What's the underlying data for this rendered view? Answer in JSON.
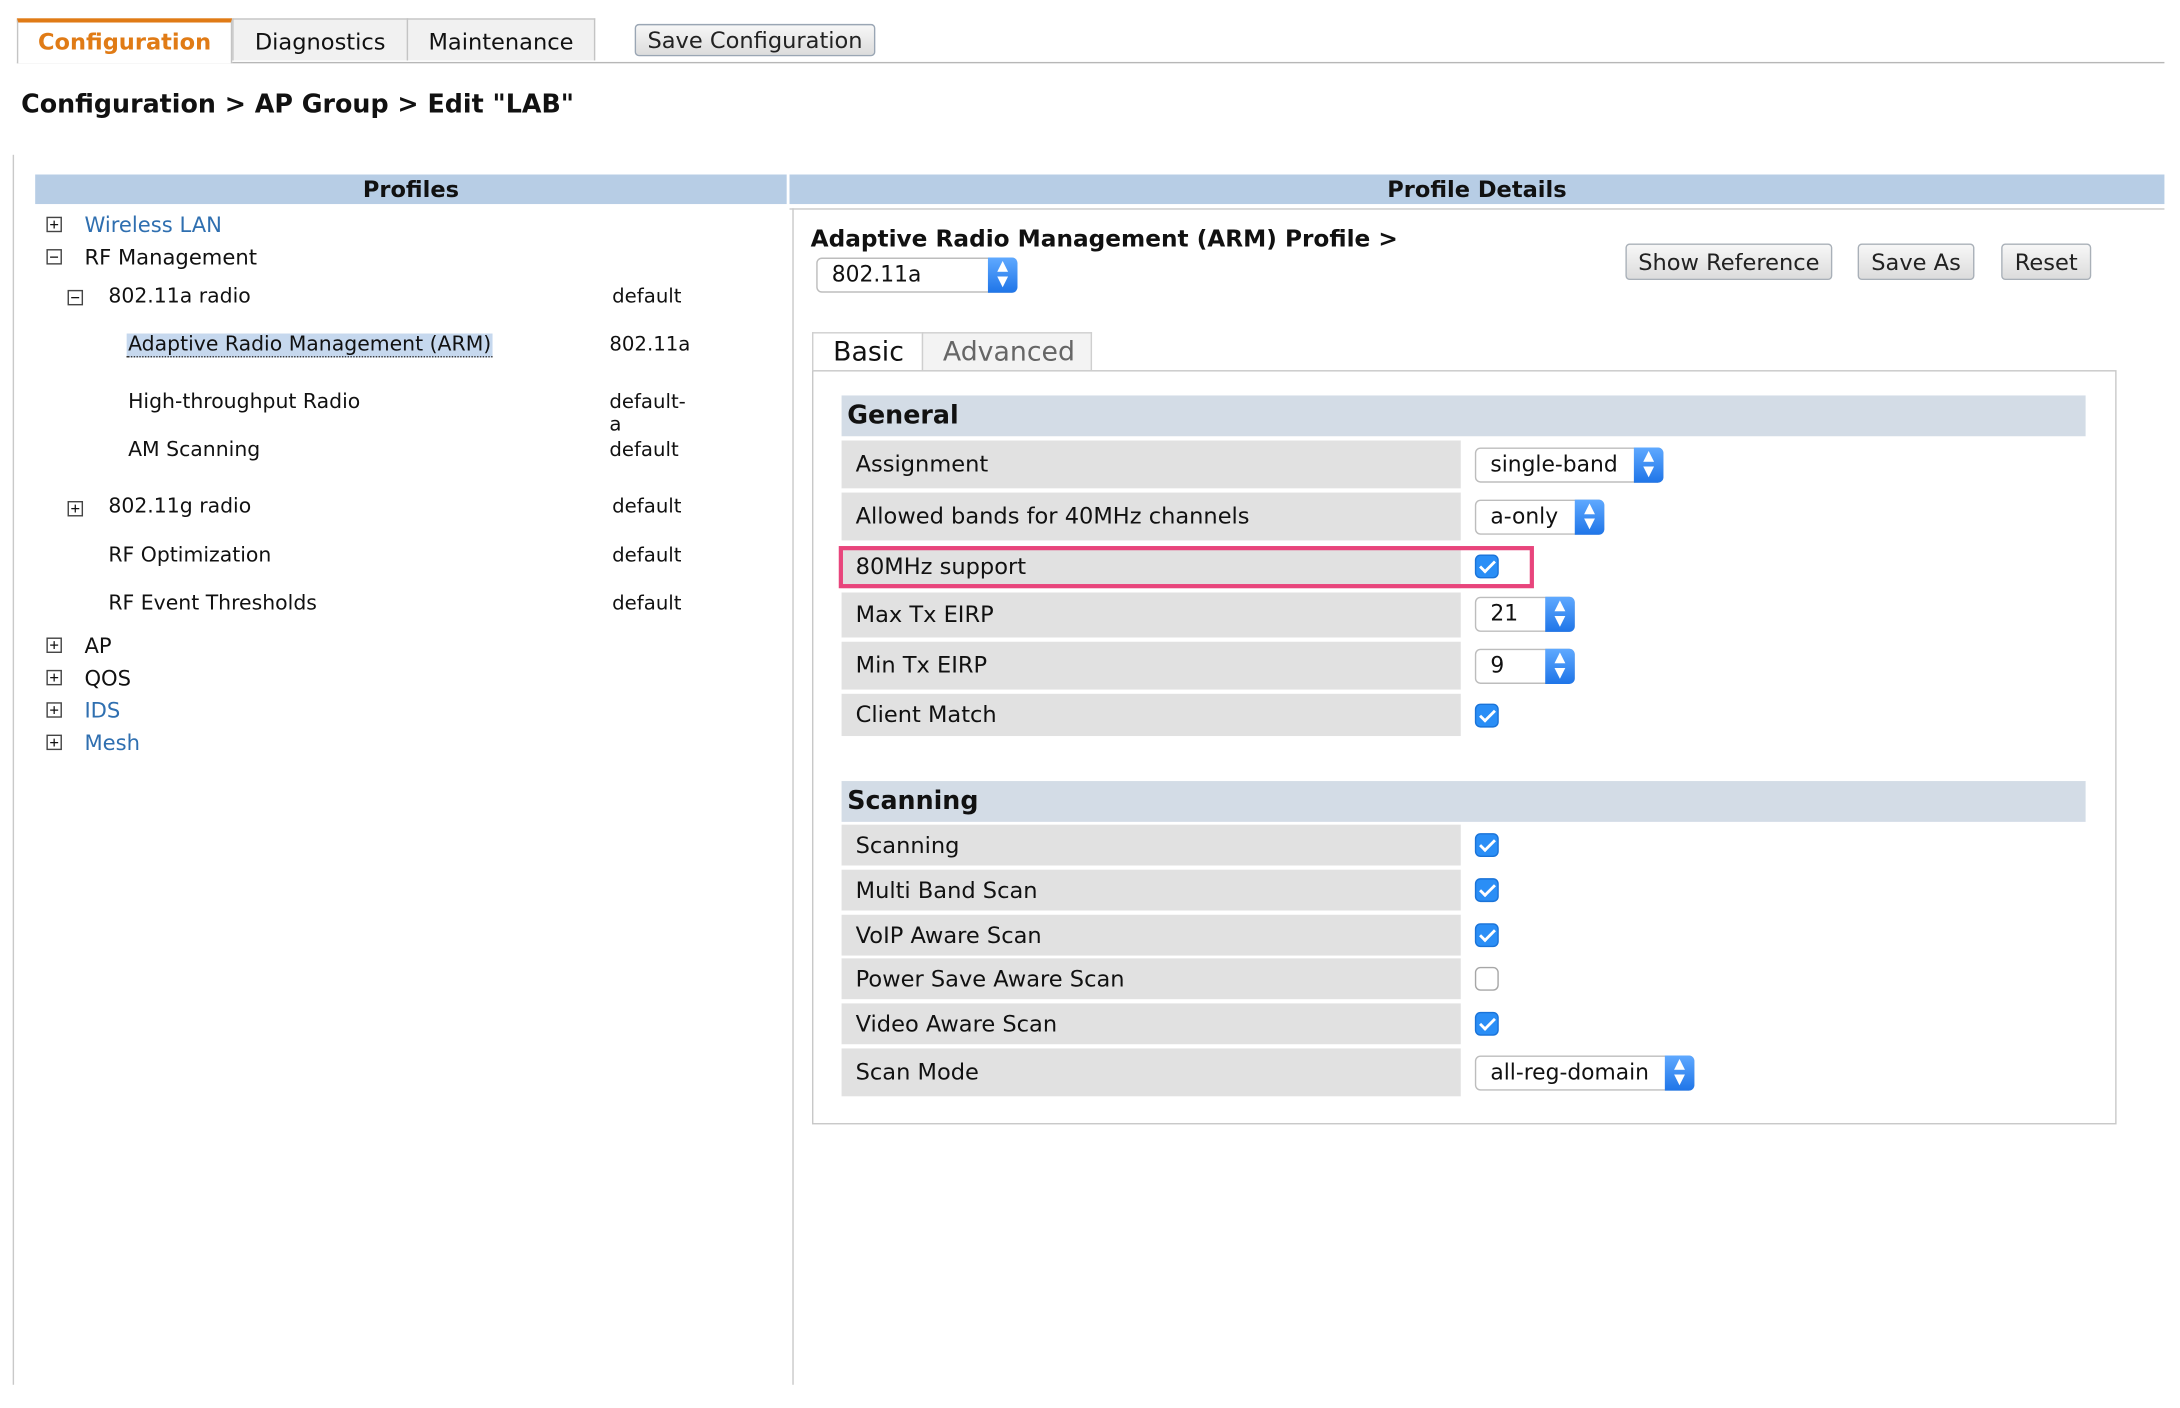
{
  "top_tabs": {
    "configuration": "Configuration",
    "diagnostics": "Diagnostics",
    "maintenance": "Maintenance",
    "save_configuration": "Save Configuration"
  },
  "breadcrumb": "Configuration > AP Group > Edit \"LAB\"",
  "profiles_header": "Profiles",
  "details_header": "Profile Details",
  "tree": {
    "wireless_lan": "Wireless LAN",
    "rf_management": "RF Management",
    "radio_a": {
      "label": "802.11a radio",
      "value": "default"
    },
    "arm": {
      "label": "Adaptive Radio Management (ARM)",
      "value": "802.11a"
    },
    "ht_radio": {
      "label": "High-throughput Radio",
      "value": "default-a"
    },
    "am_scanning": {
      "label": "AM Scanning",
      "value": "default"
    },
    "radio_g": {
      "label": "802.11g radio",
      "value": "default"
    },
    "rf_optimization": {
      "label": "RF Optimization",
      "value": "default"
    },
    "rf_event_thresholds": {
      "label": "RF Event Thresholds",
      "value": "default"
    },
    "ap": "AP",
    "qos": "QOS",
    "ids": "IDS",
    "mesh": "Mesh",
    "plus": "+",
    "minus": "−"
  },
  "detail": {
    "title": "Adaptive Radio Management (ARM) Profile >",
    "profile_select": "802.11a",
    "show_reference": "Show Reference",
    "save_as": "Save As",
    "reset": "Reset",
    "tab_basic": "Basic",
    "tab_advanced": "Advanced"
  },
  "general": {
    "header": "General",
    "assignment": {
      "label": "Assignment",
      "value": "single-band"
    },
    "allowed_bands": {
      "label": "Allowed bands for 40MHz channels",
      "value": "a-only"
    },
    "support_80mhz": {
      "label": "80MHz support",
      "checked": true
    },
    "max_tx_eirp": {
      "label": "Max Tx EIRP",
      "value": "21"
    },
    "min_tx_eirp": {
      "label": "Min Tx EIRP",
      "value": "9"
    },
    "client_match": {
      "label": "Client Match",
      "checked": true
    }
  },
  "scanning": {
    "header": "Scanning",
    "scanning": {
      "label": "Scanning",
      "checked": true
    },
    "multi_band_scan": {
      "label": "Multi Band Scan",
      "checked": true
    },
    "voip_aware_scan": {
      "label": "VoIP Aware Scan",
      "checked": true
    },
    "power_save_aware_scan": {
      "label": "Power Save Aware Scan",
      "checked": false
    },
    "video_aware_scan": {
      "label": "Video Aware Scan",
      "checked": true
    },
    "scan_mode": {
      "label": "Scan Mode",
      "value": "all-reg-domain"
    }
  },
  "colors": {
    "accent": "#e07b16",
    "header_bg": "#b7cde5",
    "link": "#2f6fb0",
    "highlight": "#e8457c",
    "checkbox": "#2a8ef6"
  }
}
